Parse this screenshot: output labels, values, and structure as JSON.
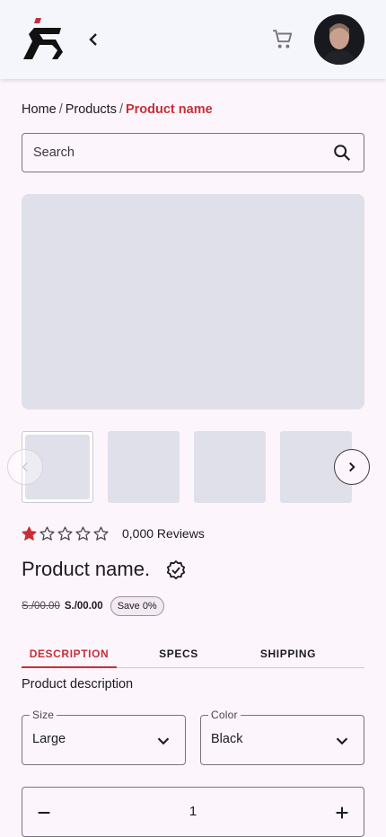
{
  "header": {
    "logo_icon": "brand-logo",
    "back_icon": "chevron-left-icon",
    "cart_icon": "cart-icon",
    "avatar": "user-avatar"
  },
  "breadcrumb": {
    "items": [
      "Home",
      "Products",
      "Product name"
    ],
    "separator": "/"
  },
  "search": {
    "placeholder": "Search",
    "icon": "search-icon"
  },
  "product": {
    "rating": 1,
    "rating_max": 5,
    "reviews_label": "0,000 Reviews",
    "name": "Product name.",
    "old_price": "S./00.00",
    "new_price": "S./00.00",
    "save_badge": "Save 0%",
    "description": "Product description"
  },
  "tabs": [
    {
      "label": "DESCRIPTION",
      "active": true
    },
    {
      "label": "SPECS",
      "active": false
    },
    {
      "label": "SHIPPING",
      "active": false
    }
  ],
  "options": {
    "size": {
      "label": "Size",
      "value": "Large"
    },
    "color": {
      "label": "Color",
      "value": "Black"
    }
  },
  "quantity": {
    "value": "1"
  },
  "colors": {
    "accent": "#c62f37",
    "placeholder": "#dfe0ea",
    "background": "#fdf5fc"
  }
}
